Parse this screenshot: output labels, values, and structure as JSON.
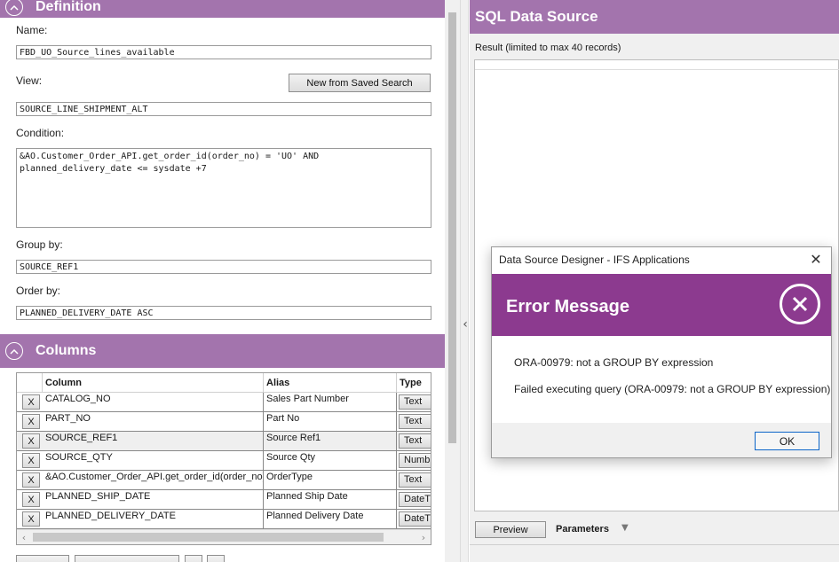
{
  "definition": {
    "section_title": "Definition",
    "name_label": "Name:",
    "name_value": "FBD_UO_Source_lines_available",
    "view_label": "View:",
    "new_saved_search_label": "New from Saved Search",
    "view_value": "SOURCE_LINE_SHIPMENT_ALT",
    "condition_label": "Condition:",
    "condition_value": "&AO.Customer_Order_API.get_order_id(order_no) = 'UO' AND\nplanned_delivery_date <= sysdate +7",
    "group_by_label": "Group by:",
    "group_by_value": "SOURCE_REF1",
    "order_by_label": "Order by:",
    "order_by_value": "PLANNED_DELIVERY_DATE ASC"
  },
  "columns": {
    "section_title": "Columns",
    "headers": {
      "column": "Column",
      "alias": "Alias",
      "type": "Type"
    },
    "rows": [
      {
        "remove": "X",
        "column": "CATALOG_NO",
        "alias": "Sales Part Number",
        "type": "Text"
      },
      {
        "remove": "X",
        "column": "PART_NO",
        "alias": "Part No",
        "type": "Text"
      },
      {
        "remove": "X",
        "column": "SOURCE_REF1",
        "alias": "Source Ref1",
        "type": "Text"
      },
      {
        "remove": "X",
        "column": "SOURCE_QTY",
        "alias": "Source Qty",
        "type": "Numb"
      },
      {
        "remove": "X",
        "column": "&AO.Customer_Order_API.get_order_id(order_no)",
        "alias": "OrderType",
        "type": "Text"
      },
      {
        "remove": "X",
        "column": "PLANNED_SHIP_DATE",
        "alias": "Planned Ship Date",
        "type": "DateTi"
      },
      {
        "remove": "X",
        "column": "PLANNED_DELIVERY_DATE",
        "alias": "Planned Delivery Date",
        "type": "DateTi"
      }
    ]
  },
  "sql_panel": {
    "title": "SQL Data Source",
    "result_label": "Result (limited to max 40 records)",
    "preview_label": "Preview",
    "parameters_label": "Parameters"
  },
  "dialog": {
    "window_title": "Data Source Designer - IFS Applications",
    "heading": "Error Message",
    "message_line1": "ORA-00979: not a GROUP BY expression",
    "message_line2": "Failed executing query (ORA-00979: not a GROUP BY expression)",
    "ok_label": "OK"
  },
  "icons": {
    "collapse": "chevron-up-icon",
    "close": "close-icon",
    "error": "error-circle-x-icon",
    "dropdown": "caret-down-icon",
    "splitter": "chevron-left-icon"
  },
  "colors": {
    "section_header": "#a374ad",
    "dialog_banner": "#8c3a8f",
    "ok_button_border": "#0a64c8"
  }
}
